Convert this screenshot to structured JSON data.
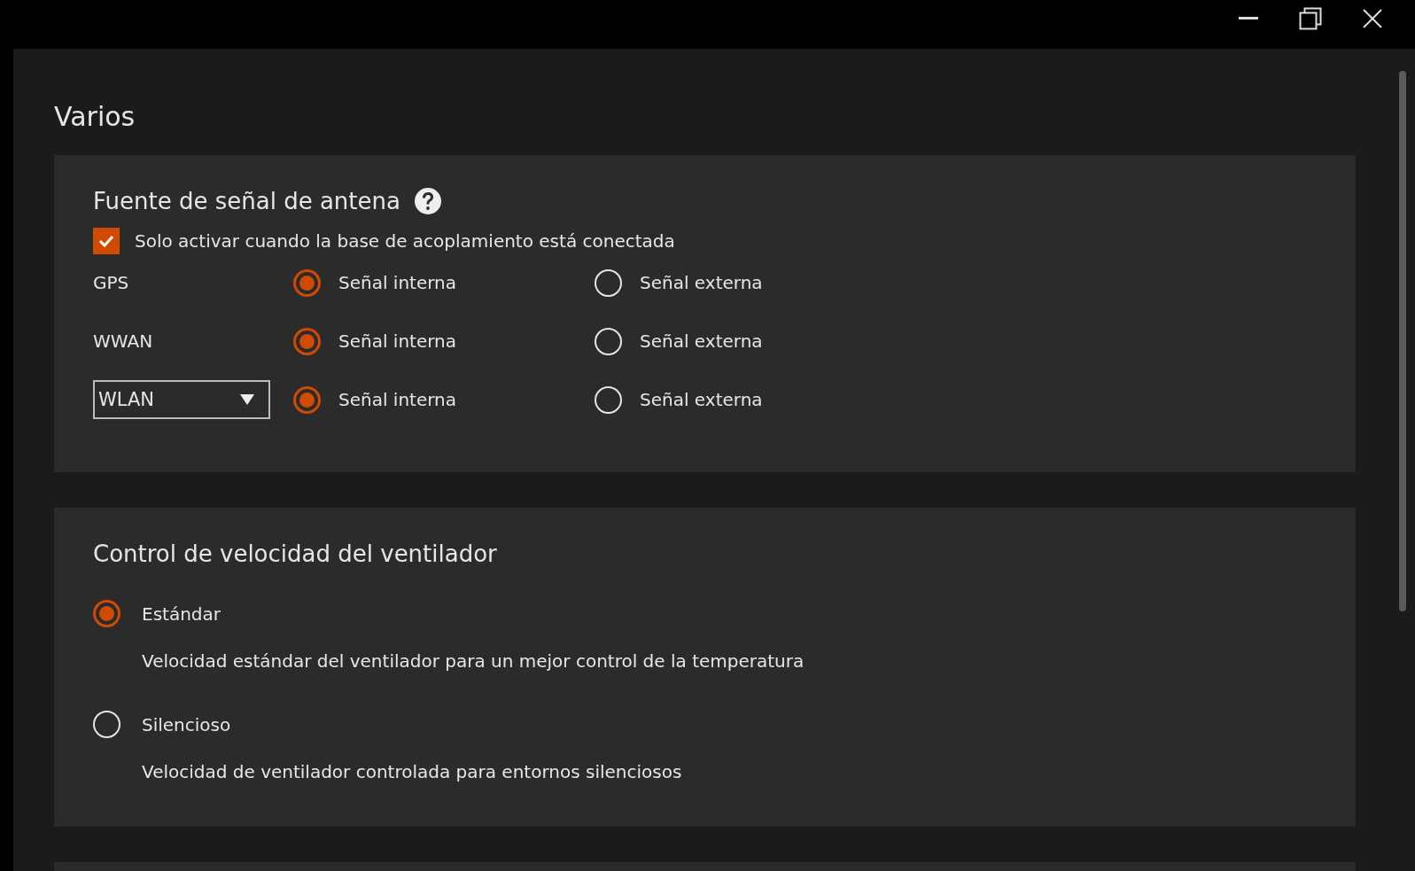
{
  "page_title": "Varios",
  "antenna": {
    "title": "Fuente de señal de antena",
    "dock_only": {
      "label": "Solo activar cuando la base de acoplamiento está conectada",
      "checked": true
    },
    "rows": [
      {
        "kind": "label",
        "label": "GPS",
        "options": [
          {
            "label": "Señal interna",
            "selected": true
          },
          {
            "label": "Señal externa",
            "selected": false
          }
        ]
      },
      {
        "kind": "label",
        "label": "WWAN",
        "options": [
          {
            "label": "Señal interna",
            "selected": true
          },
          {
            "label": "Señal externa",
            "selected": false
          }
        ]
      },
      {
        "kind": "dropdown",
        "label": "WLAN",
        "options": [
          {
            "label": "Señal interna",
            "selected": true
          },
          {
            "label": "Señal externa",
            "selected": false
          }
        ]
      }
    ]
  },
  "fan": {
    "title": "Control de velocidad del ventilador",
    "options": [
      {
        "label": "Estándar",
        "description": "Velocidad estándar del ventilador para un mejor control de la temperatura",
        "selected": true
      },
      {
        "label": "Silencioso",
        "description": "Velocidad de ventilador controlada para entornos silenciosos",
        "selected": false
      }
    ]
  }
}
